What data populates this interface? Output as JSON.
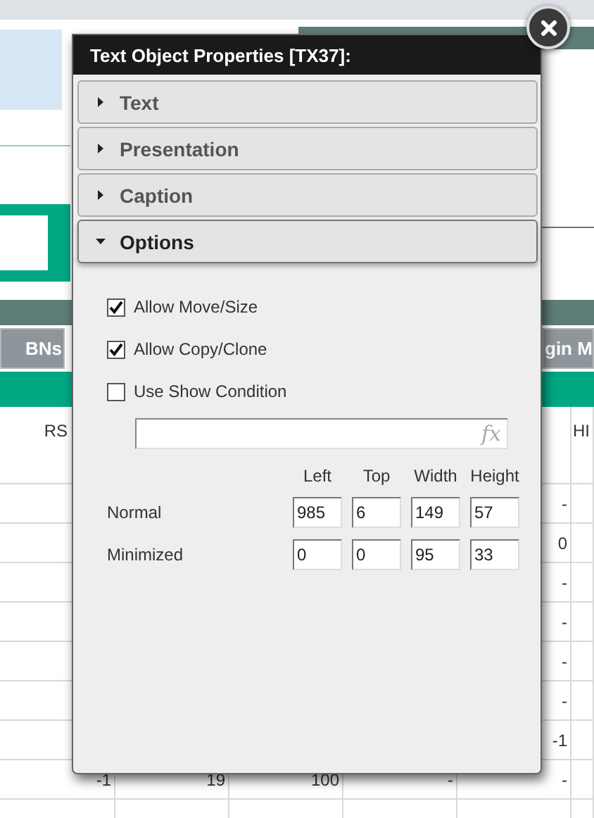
{
  "background": {
    "tabs": [
      "BNs",
      "gin M"
    ],
    "table": {
      "header": {
        "column_1": "RS",
        "column_6": "HI"
      },
      "rows": [
        {
          "column_5": "-"
        },
        {
          "column_5": "0"
        },
        {
          "column_5": "-"
        },
        {
          "column_5": "-"
        },
        {
          "column_5": "-"
        },
        {
          "column_5": "-"
        },
        {
          "column_5": "-1"
        },
        {
          "column_1": "-1",
          "column_2": "19",
          "column_3": "100",
          "column_4": "-",
          "column_5": "-"
        }
      ]
    }
  },
  "dialog": {
    "title": "Text Object Properties [TX37]:",
    "sections": [
      {
        "label": "Text",
        "expanded": false
      },
      {
        "label": "Presentation",
        "expanded": false
      },
      {
        "label": "Caption",
        "expanded": false
      },
      {
        "label": "Options",
        "expanded": true
      }
    ],
    "options": [
      {
        "label": "Allow Move/Size",
        "checked": true
      },
      {
        "label": "Allow Copy/Clone",
        "checked": true
      },
      {
        "label": "Use Show Condition",
        "checked": false
      }
    ],
    "condition_field": {
      "icon_text": "fx"
    },
    "geometry": {
      "columns": [
        "Left",
        "Top",
        "Width",
        "Height"
      ],
      "rows": [
        {
          "label": "Normal",
          "values": [
            "985",
            "6",
            "149",
            "57"
          ]
        },
        {
          "label": "Minimized",
          "values": [
            "0",
            "0",
            "95",
            "33"
          ]
        }
      ]
    }
  }
}
